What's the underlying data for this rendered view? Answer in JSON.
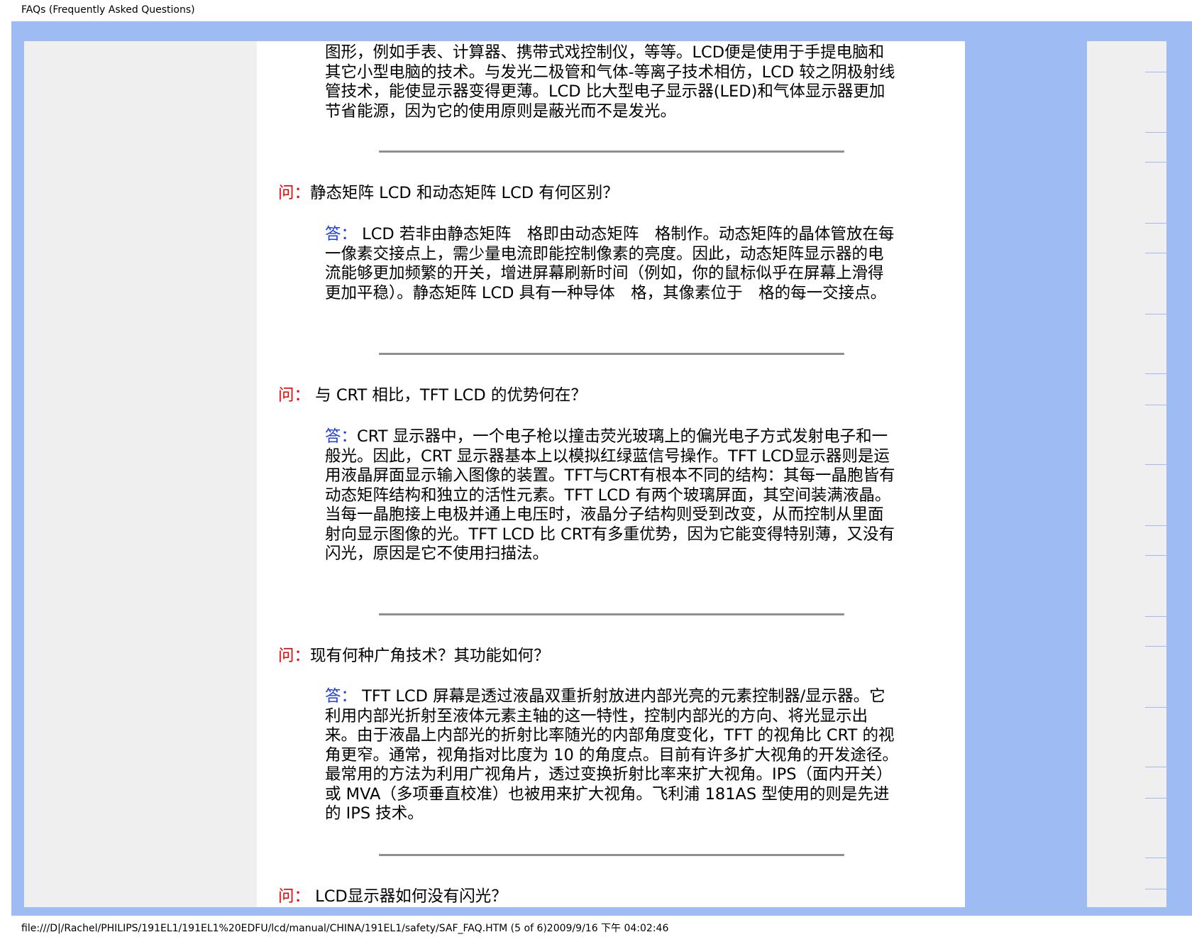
{
  "header": {
    "title": "FAQs (Frequently Asked Questions)"
  },
  "footer": {
    "path": "file:///D|/Rachel/PHILIPS/191EL1/191EL1%20EDFU/lcd/manual/CHINA/191EL1/safety/SAF_FAQ.HTM (5 of 6)2009/9/16 下午 04:02:46"
  },
  "content": {
    "intro_text": "图形，例如手表、计算器、携带式戏控制仪，等等。LCD便是使用于手提电脑和其它小型电脑的技术。与发光二极管和气体-等离子技术相仿，LCD 较之阴极射线管技术，能使显示器变得更薄。LCD 比大型电子显示器(LED)和气体显示器更加节省能源，因为它的使用原则是蔽光而不是发光。",
    "faqs": [
      {
        "q_label": "问：",
        "question": "静态矩阵 LCD 和动态矩阵 LCD 有何区别？",
        "a_label": "答：",
        "answer": " LCD 若非由静态矩阵　格即由动态矩阵　格制作。动态矩阵的晶体管放在每一像素交接点上，需少量电流即能控制像素的亮度。因此，动态矩阵显示器的电流能够更加频繁的开关，增进屏幕刷新时间（例如，你的鼠标似乎在屏幕上滑得更加平稳）。静态矩阵 LCD 具有一种导体　格，其像素位于　格的每一交接点。"
      },
      {
        "q_label": "问：",
        "question": " 与 CRT 相比，TFT LCD 的优势何在？",
        "a_label": "答：",
        "answer": "CRT 显示器中，一个电子枪以撞击荧光玻璃上的偏光电子方式发射电子和一般光。因此，CRT 显示器基本上以模拟红绿蓝信号操作。TFT LCD显示器则是运用液晶屏面显示输入图像的装置。TFT与CRT有根本不同的结构：其每一晶胞皆有动态矩阵结构和独立的活性元素。TFT LCD 有两个玻璃屏面，其空间装满液晶。当每一晶胞接上电极并通上电压时，液晶分子结构则受到改变，从而控制从里面射向显示图像的光。TFT LCD 比 CRT有多重优势，因为它能变得特别薄，又没有闪光，原因是它不使用扫描法。"
      },
      {
        "q_label": "问：",
        "question": "现有何种广角技术？其功能如何？",
        "a_label": "答：",
        "answer": " TFT LCD 屏幕是透过液晶双重折射放进内部光亮的元素控制器/显示器。它利用内部光折射至液体元素主轴的这一特性，控制内部光的方向、将光显示出来。由于液晶上内部光的折射比率随光的内部角度变化，TFT 的视角比 CRT 的视角更窄。通常，视角指对比度为 10 的角度点。目前有许多扩大视角的开发途径。最常用的方法为利用广视角片，透过变换折射比率来扩大视角。IPS（面内开关）或 MVA（多项垂直校准）也被用来扩大视角。飞利浦 181AS 型使用的则是先进的 IPS 技术。"
      },
      {
        "q_label": "问：",
        "question": " LCD显示器如何没有闪光？"
      }
    ]
  }
}
